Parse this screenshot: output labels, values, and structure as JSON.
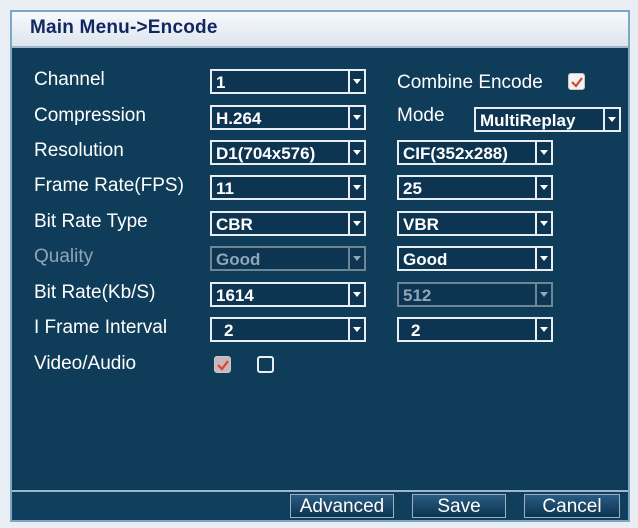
{
  "title": "Main Menu->Encode",
  "labels": {
    "channel": "Channel",
    "compression": "Compression",
    "resolution": "Resolution",
    "frame_rate": "Frame Rate(FPS)",
    "bit_rate_type": "Bit Rate Type",
    "quality": "Quality",
    "bit_rate": "Bit Rate(Kb/S)",
    "iframe": "I Frame Interval",
    "video_audio": "Video/Audio",
    "combine_encode": "Combine Encode",
    "mode": "Mode"
  },
  "main_stream": {
    "channel": "1",
    "compression": "H.264",
    "resolution": "D1(704x576)",
    "frame_rate": "11",
    "bit_rate_type": "CBR",
    "quality": "Good",
    "bit_rate": "1614",
    "iframe": "2",
    "video_checked": true,
    "quality_disabled": true
  },
  "extra_stream": {
    "mode": "MultiReplay",
    "resolution": "CIF(352x288)",
    "frame_rate": "25",
    "bit_rate_type": "VBR",
    "quality": "Good",
    "bit_rate": "512",
    "iframe": "2",
    "audio_checked": false,
    "bit_rate_disabled": true
  },
  "combine_encode_checked": true,
  "buttons": {
    "advanced": "Advanced",
    "save": "Save",
    "cancel": "Cancel"
  },
  "colors": {
    "background": "#0f3c58",
    "titlebar": "#f1f4f8",
    "title_text": "#12265f",
    "checkmark": "#d6462f"
  }
}
